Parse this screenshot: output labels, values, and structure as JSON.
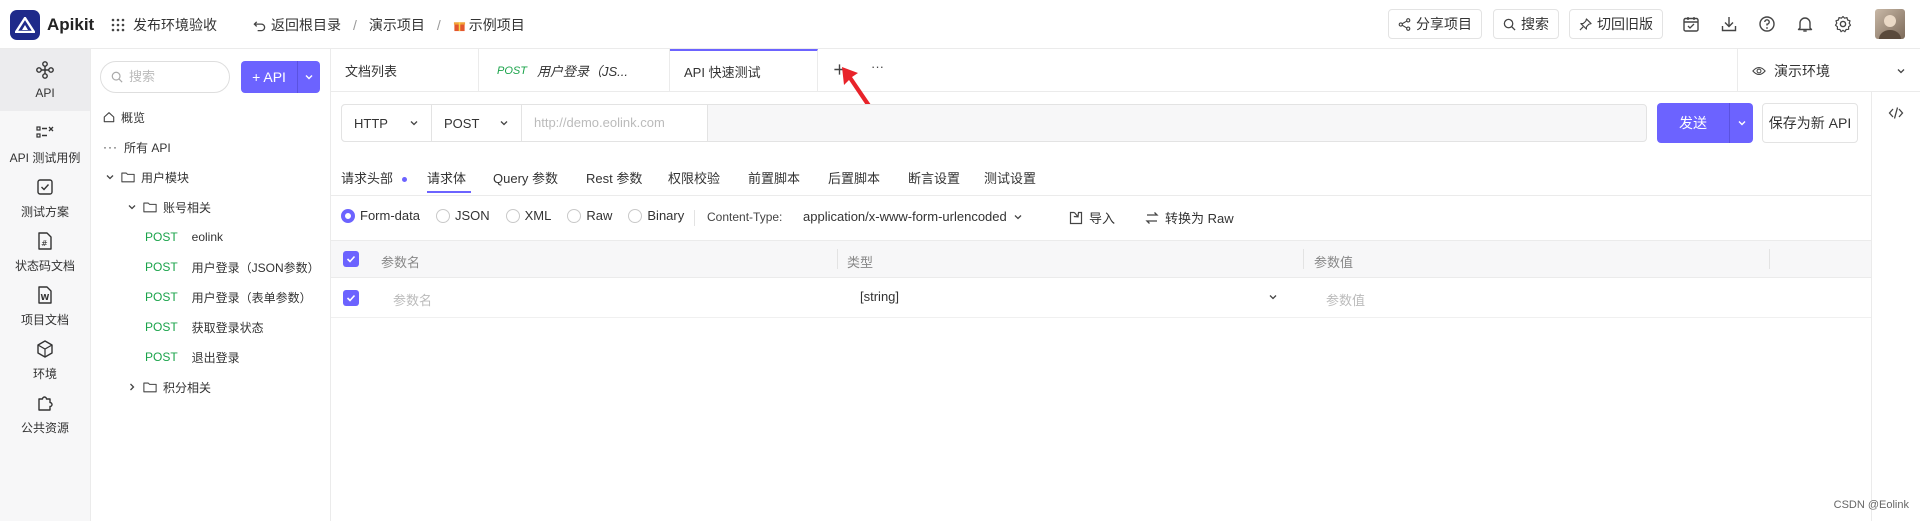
{
  "app": {
    "name": "Apikit",
    "project_switch": "发布环境验收"
  },
  "header": {
    "back_root": "返回根目录",
    "crumb_sep": "/",
    "crumb_project": "演示项目",
    "crumb_current": "示例项目",
    "share": "分享项目",
    "search": "搜索",
    "switch_old": "切回旧版"
  },
  "rail": [
    {
      "label": "API"
    },
    {
      "label": "API 测试用例"
    },
    {
      "label": "测试方案"
    },
    {
      "label": "状态码文档"
    },
    {
      "label": "项目文档"
    },
    {
      "label": "环境"
    },
    {
      "label": "公共资源"
    }
  ],
  "tree": {
    "search_placeholder": "搜索",
    "add_api": "+ API",
    "overview": "概览",
    "all_api": "所有 API",
    "group_user": "用户模块",
    "group_account": "账号相关",
    "group_points": "积分相关",
    "method": "POST",
    "apis": [
      "eolink",
      "用户登录（JSON参数）",
      "用户登录（表单参数）",
      "获取登录状态",
      "退出登录"
    ]
  },
  "tabs": {
    "doc_list": "文档列表",
    "tab2_method": "POST",
    "tab2_name": "用户登录（JS...",
    "tab3_name": "API 快速测试",
    "more": "···",
    "env": "演示环境"
  },
  "request": {
    "protocol": "HTTP",
    "method": "POST",
    "url_placeholder": "http://demo.eolink.com",
    "send": "发送",
    "save_new": "保存为新 API"
  },
  "sub_tabs": [
    "请求头部",
    "请求体",
    "Query 参数",
    "Rest 参数",
    "权限校验",
    "前置脚本",
    "后置脚本",
    "断言设置",
    "测试设置"
  ],
  "body_types": [
    "Form-data",
    "JSON",
    "XML",
    "Raw",
    "Binary"
  ],
  "content_type": {
    "label": "Content-Type:",
    "value": "application/x-www-form-urlencoded"
  },
  "actions": {
    "import": "导入",
    "to_raw": "转换为 Raw"
  },
  "table": {
    "headers": [
      "参数名",
      "类型",
      "参数值"
    ],
    "row": {
      "name_placeholder": "参数名",
      "type": "[string]",
      "value_placeholder": "参数值"
    }
  },
  "watermark": "CSDN @Eolink",
  "colors": {
    "accent": "#6c63ff",
    "post": "#1aa34a",
    "arrow": "#e8232a"
  }
}
